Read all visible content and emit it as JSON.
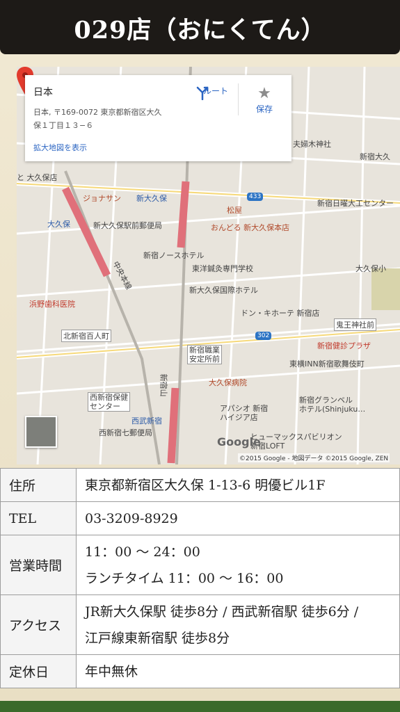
{
  "header": {
    "title": "029店（おにくてん）"
  },
  "map": {
    "info_card": {
      "title": "日本",
      "address_line1": "日本, 〒169-0072 東京都新宿区大久",
      "address_line2": "保１丁目１３−６",
      "enlarge_link": "拡大地図を表示",
      "route_label": "ルート",
      "save_label": "保存"
    },
    "labels": {
      "fuufu": "夫婦木神社",
      "shinjuku_okubo_kindergarten": "新宿大久",
      "okubo_shop": "と 大久保店",
      "jonasan": "ジョナサン",
      "shin_okubo": "新大久保",
      "route433": "433",
      "shinjuku_nichiyou": "新宿日曜大工センター",
      "okubo": "大久保",
      "shin_okubo_post": "新大久保駅前郵便局",
      "matsuya": "松屋",
      "ondoru": "おんどる 新大久保本店",
      "north_hotel": "新宿ノースホテル",
      "touyou": "東洋鍼灸専門学校",
      "okubo_small": "大久保小",
      "chuo": "中央本線",
      "hamano": "浜野歯科医院",
      "international_hotel": "新大久保国際ホテル",
      "don_quijote": "ドン・キホーテ 新宿店",
      "kio_shrine": "鬼王神社前",
      "kitashinjuku": "北新宿百人町",
      "route302": "302",
      "kenshin": "新宿健診プラザ",
      "shokuan": "新宿職業\n安定所前",
      "toyoko": "東横INN新宿歌舞伎町",
      "okubo_hospital": "大久保病院",
      "yamanote": "新宿山",
      "hoken": "西新宿保健\nセンター",
      "granbell": "新宿グランベル\nホテル(Shinjuku…",
      "apa": "アパシオ 新宿\nハイジア店",
      "seibu": "西武新宿",
      "post7": "西新宿七郵便局",
      "humax": "ヒューマックスパビリオン\n新宿LOFT",
      "google": "Google",
      "copyright": "©2015 Google - 地図データ ©2015 Google, ZEN"
    }
  },
  "info": {
    "rows": [
      {
        "label": "住所",
        "lines": [
          "東京都新宿区大久保 1-13-6 明優ビル1F"
        ]
      },
      {
        "label": "TEL",
        "lines": [
          "03-3209-8929"
        ]
      },
      {
        "label": "営業時間",
        "lines": [
          "11：00 〜 24：00",
          "ランチタイム 11：00 〜 16：00"
        ]
      },
      {
        "label": "アクセス",
        "lines": [
          "JR新大久保駅 徒歩8分 / 西武新宿駅 徒歩6分 /",
          "江戸線東新宿駅 徒歩8分"
        ]
      },
      {
        "label": "定休日",
        "lines": [
          "年中無休"
        ]
      }
    ]
  }
}
